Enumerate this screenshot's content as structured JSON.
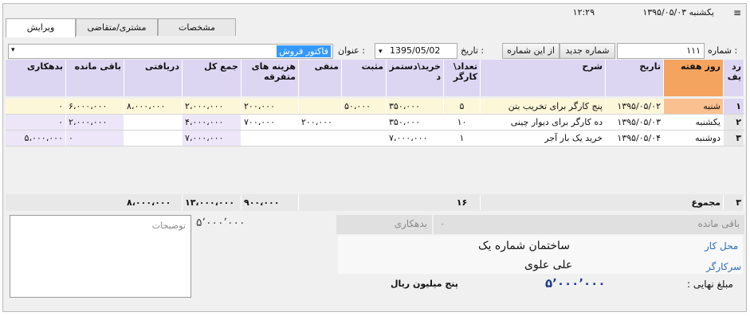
{
  "header": {
    "menu_glyph": "≡",
    "date_text": "یکشنبه ۱۳۹۵/۰۵/۰۳",
    "time_text": "۱۲:۲۹"
  },
  "tabs": [
    {
      "label": "ویرایش"
    },
    {
      "label": "مشتری/متقاضی"
    },
    {
      "label": "مشخصات"
    }
  ],
  "form": {
    "number_label": "شماره :",
    "number_value": "۱۱۱",
    "new_number_button": "شماره جدید",
    "from_this_number_button": "از این شماره",
    "date_label": "تاریخ :",
    "date_value": "1395/05/02",
    "title_label": "عنوان :",
    "title_value": "فاکتور فروش"
  },
  "grid": {
    "headers": [
      "رد یف",
      "روز هفته",
      "تاریخ",
      "شرح",
      "تعداد\\ کارگر",
      "خرید\\دستمز د",
      "مثبت",
      "منفی",
      "هزینه های متفرقه",
      "جمع کل",
      "دریافتی",
      "باقی مانده",
      "بدهکاری"
    ],
    "rows": [
      {
        "num": "۱",
        "day": "شنبه",
        "date": "۱۳۹۵/۰۵/۰۲",
        "desc": "پنج کارگر برای تخریب بتن",
        "count": "۵",
        "wage": "۳۵۰،۰۰۰",
        "plus": "۵۰،۰۰۰",
        "minus": "",
        "misc": "۲۰۰،۰۰۰",
        "total": "۲،۰۰۰،۰۰۰",
        "received": "۸،۰۰۰،۰۰۰",
        "remain": "۶،۰۰۰،۰۰۰",
        "debt": "۰"
      },
      {
        "num": "۲",
        "day": "یکشنبه",
        "date": "۱۳۹۵/۰۵/۰۳",
        "desc": "ده کارگر برای دیوار چینی",
        "count": "۱۰",
        "wage": "۳۵۰،۰۰۰",
        "plus": "",
        "minus": "۲۰۰،۰۰۰",
        "misc": "۷۰۰،۰۰۰",
        "total": "۴،۰۰۰،۰۰۰",
        "received": "",
        "remain": "۲،۰۰۰،۰۰۰",
        "debt": "۰"
      },
      {
        "num": "۳",
        "day": "دوشنبه",
        "date": "۱۳۹۵/۰۵/۰۴",
        "desc": "خرید یک بار آجر",
        "count": "۱",
        "wage": "۷،۰۰۰،۰۰۰",
        "plus": "",
        "minus": "",
        "misc": "",
        "total": "۷،۰۰۰،۰۰۰",
        "received": "",
        "remain": "۰",
        "debt": "۵،۰۰۰،۰۰۰"
      }
    ],
    "totals": {
      "num": "۳",
      "label": "مجموع",
      "count": "۱۶",
      "misc": "۹۰۰،۰۰۰",
      "total": "۱۳،۰۰۰،۰۰۰",
      "received": "۸،۰۰۰،۰۰۰"
    }
  },
  "summary": {
    "remain_label": "باقی مانده",
    "remain_value": "۰",
    "debt_label": "بدهکاری",
    "debt_value": "۵٬۰۰۰٬۰۰۰",
    "notes_placeholder": "توضیحات",
    "worksite_label": "محل کار",
    "worksite_value": "ساختمان شماره یک",
    "foreman_label": "سرکارگر",
    "foreman_value": "علی علوی",
    "final_label": "مبلغ نهایی :",
    "final_value": "۵٬۰۰۰٬۰۰۰",
    "final_words": "پنج میلیون  ریال"
  }
}
